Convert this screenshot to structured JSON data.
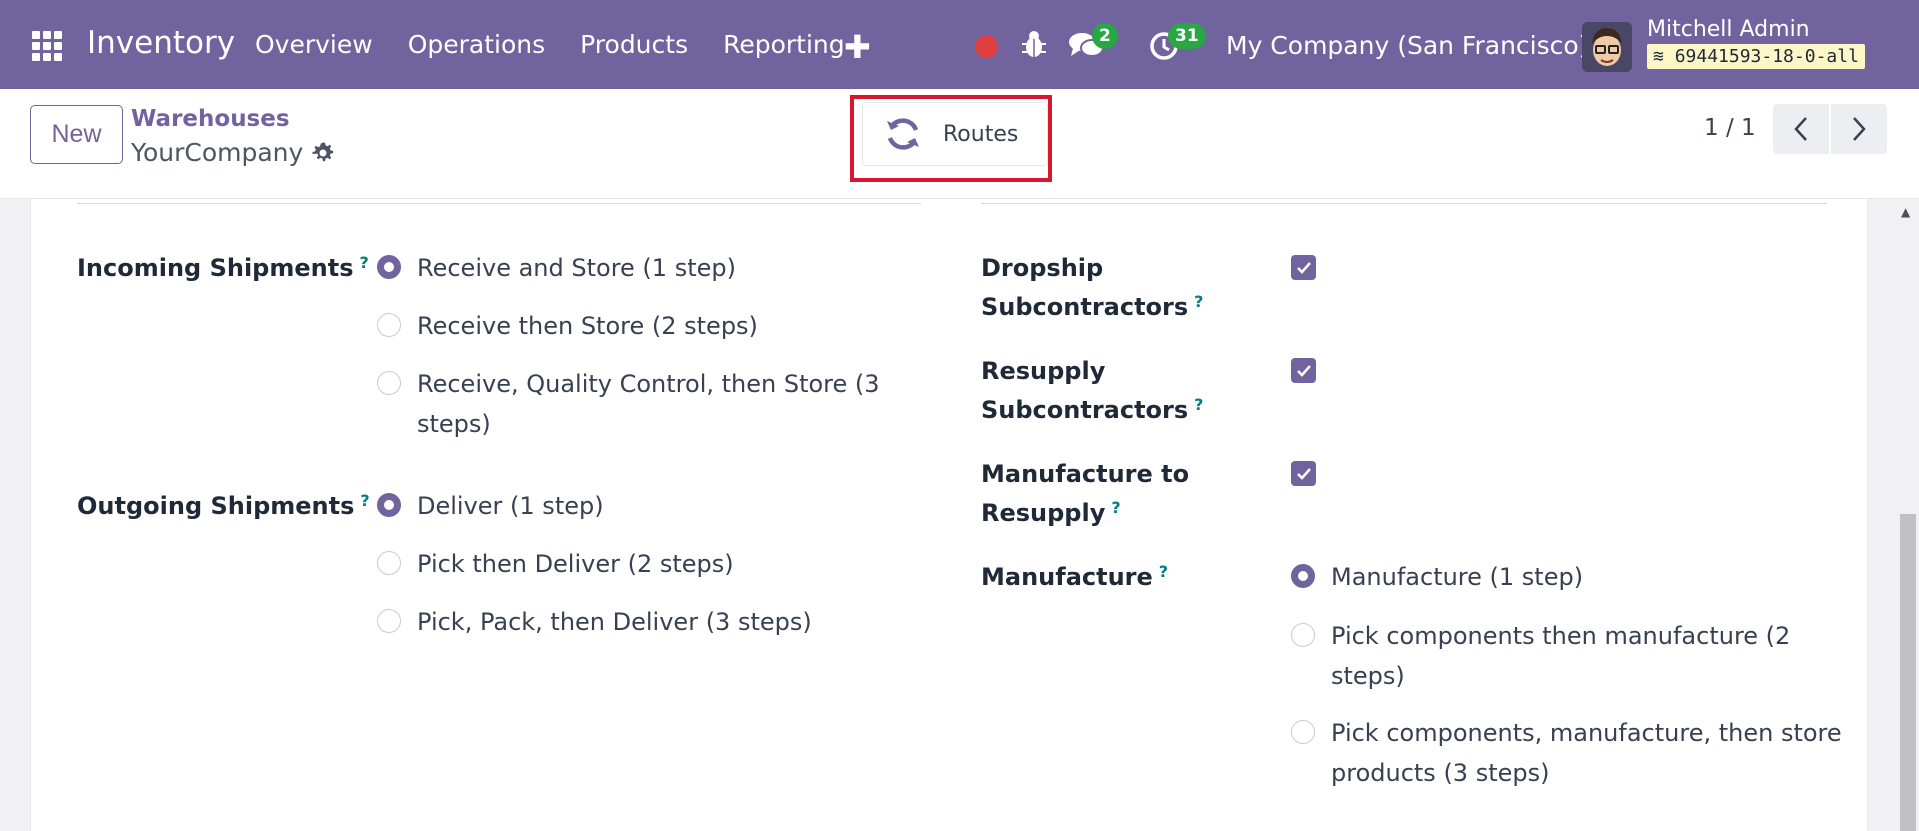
{
  "navbar": {
    "brand": "Inventory",
    "menu": [
      "Overview",
      "Operations",
      "Products",
      "Reporting"
    ],
    "messages_count": "2",
    "activities_count": "31",
    "company": "My Company (San Francisco)",
    "user_name": "Mitchell Admin",
    "database": "69441593-18-0-all",
    "accent": "#71639e"
  },
  "control_panel": {
    "new_label": "New",
    "breadcrumb_parent": "Warehouses",
    "breadcrumb_current": "YourCompany",
    "routes_label": "Routes",
    "pager": "1 / 1"
  },
  "form": {
    "incoming": {
      "label": "Incoming Shipments",
      "help": "?",
      "options": [
        "Receive and Store (1 step)",
        "Receive then Store (2 steps)",
        "Receive, Quality Control, then Store (3",
        "steps)"
      ],
      "selected": "Receive and Store (1 step)"
    },
    "outgoing": {
      "label": "Outgoing Shipments",
      "help": "?",
      "options": [
        "Deliver (1 step)",
        "Pick then Deliver (2 steps)",
        "Pick, Pack, then Deliver (3 steps)"
      ],
      "selected": "Deliver (1 step)"
    },
    "dropship": {
      "label1": "Dropship",
      "label2": "Subcontractors",
      "help": "?",
      "checked": true
    },
    "resupply": {
      "label1": "Resupply",
      "label2": "Subcontractors",
      "help": "?",
      "checked": true
    },
    "manufacture_resupply": {
      "label1": "Manufacture to",
      "label2": "Resupply",
      "help": "?",
      "checked": true
    },
    "manufacture": {
      "label": "Manufacture",
      "help": "?",
      "options": [
        "Manufacture (1 step)",
        "Pick components then manufacture (2",
        "steps)",
        "Pick components, manufacture, then store",
        "products (3 steps)"
      ],
      "selected": "Manufacture (1 step)"
    }
  }
}
